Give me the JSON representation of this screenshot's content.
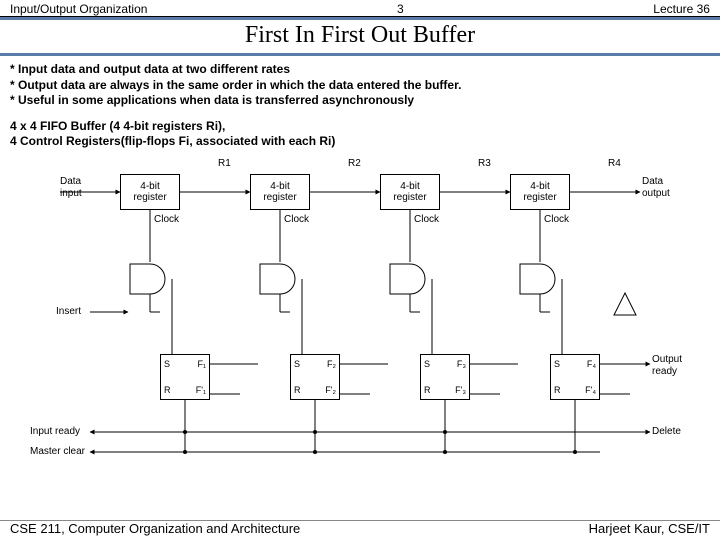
{
  "header": {
    "left": "Input/Output Organization",
    "center": "3",
    "right": "Lecture 36"
  },
  "title": "First In First Out Buffer",
  "bullets": {
    "b1": "* Input data and output data at two different rates",
    "b2": "* Output data are always in the same order in which the data entered the buffer.",
    "b3": "* Useful in some applications when data is transferred asynchronously"
  },
  "desc": {
    "line1": "4 x 4 FIFO Buffer (4  4-bit registers Ri),",
    "line2": "4 Control Registers(flip-flops Fi, associated with each Ri)"
  },
  "diagram": {
    "r1": "R1",
    "r2": "R2",
    "r3": "R3",
    "r4": "R4",
    "reg_label_1": "4-bit",
    "reg_label_2": "register",
    "clock": "Clock",
    "data_input_1": "Data",
    "data_input_2": "input",
    "data_output_1": "Data",
    "data_output_2": "output",
    "insert": "Insert",
    "output_ready_1": "Output",
    "output_ready_2": "ready",
    "delete": "Delete",
    "input_ready": "Input ready",
    "master_clear": "Master clear",
    "S": "S",
    "R": "R",
    "F1": "F₁",
    "F1b": "F'₁",
    "F2": "F₂",
    "F2b": "F'₂",
    "F3": "F₃",
    "F3b": "F'₃",
    "F4": "F₄",
    "F4b": "F'₄"
  },
  "footer": {
    "left": "CSE 211, Computer Organization and Architecture",
    "right": "Harjeet Kaur, CSE/IT"
  }
}
